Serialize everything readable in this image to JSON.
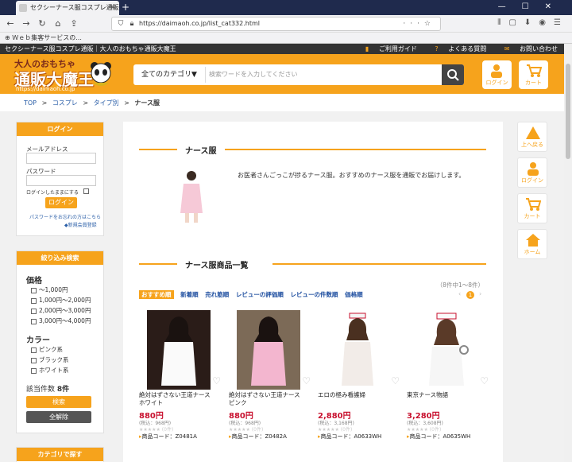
{
  "browser": {
    "tab_title": "セクシーナース服コスプレ通販｜大人",
    "tab_close": "✕",
    "new_tab": "+",
    "url": "https://daimaoh.co.jp/list_cat332.html",
    "bookmark": "Ｗｅｂ集客サービスの..."
  },
  "site": {
    "top_strip": "セクシーナース服コスプレ通販｜大人のおもちゃ通販大魔王",
    "guide": "ご利用ガイド",
    "faq": "よくある質問",
    "contact": "お問い合わせ",
    "logo_top": "大人のおもちゃ",
    "logo_main": "通販大魔王",
    "logo_url": "https://daimaoh.co.jp",
    "category_select": "全てのカテゴリ▼",
    "search_placeholder": "検索ワードを入力してください",
    "login_label": "ログイン",
    "cart_label": "カート"
  },
  "breadcrumb": [
    "TOP",
    ">",
    "コスプレ",
    ">",
    "タイプ別",
    ">",
    "ナース服"
  ],
  "login_box": {
    "title": "ログイン",
    "email_label": "メールアドレス",
    "password_label": "パスワード",
    "remember": "ログインしたままにする",
    "button": "ログイン",
    "forgot": "パスワードをお忘れの方はこちら",
    "register": "◆新規会員登録"
  },
  "filter_box": {
    "title": "絞り込み検索",
    "price_title": "価格",
    "prices": [
      "～1,000円",
      "1,000円～2,000円",
      "2,000円～3,000円",
      "3,000円～4,000円"
    ],
    "color_title": "カラー",
    "colors": [
      "ピンク系",
      "ブラック系",
      "ホワイト系"
    ],
    "count_label": "該当件数",
    "count_value": "8件",
    "search_btn": "検索",
    "clear_btn": "全解除"
  },
  "category_box": {
    "title": "カテゴリで探す"
  },
  "main": {
    "section1_title": "ナース服",
    "description": "お医者さんごっこが捗るナース服。おすすめのナース服を通販でお届けします。",
    "section2_title": "ナース服商品一覧",
    "count_text": "（8件中1～8件）",
    "sort_tabs": [
      "おすすめ順",
      "新着順",
      "売れ筋順",
      "レビューの評価順",
      "レビューの件数順",
      "価格順"
    ],
    "page": "1",
    "prev": "‹",
    "next": "›"
  },
  "products": [
    {
      "name": "絶対はずさない王道ナース　ホワイト",
      "price": "880円",
      "tax": "(税込：968円)",
      "stars": "★★★★★ (0件)",
      "code": "商品コード：Z0481A"
    },
    {
      "name": "絶対はずさない王道ナース　ピンク",
      "price": "880円",
      "tax": "(税込：968円)",
      "stars": "★★★★★ (0件)",
      "code": "商品コード：Z0482A"
    },
    {
      "name": "エロの極み看護婦",
      "price": "2,880円",
      "tax": "(税込：3,168円)",
      "stars": "★★★★★ (0件)",
      "code": "商品コード：A0633WH"
    },
    {
      "name": "東京ナース物語",
      "price": "3,280円",
      "tax": "(税込：3,608円)",
      "stars": "★★★★★ (0件)",
      "code": "商品コード：A0635WH"
    }
  ],
  "right_nav": [
    "上へ戻る",
    "ログイン",
    "カート",
    "ホーム"
  ],
  "colors": {
    "accent": "#f6a31c",
    "dark": "#333333",
    "price": "#c8102e",
    "link": "#2b5fa8"
  }
}
